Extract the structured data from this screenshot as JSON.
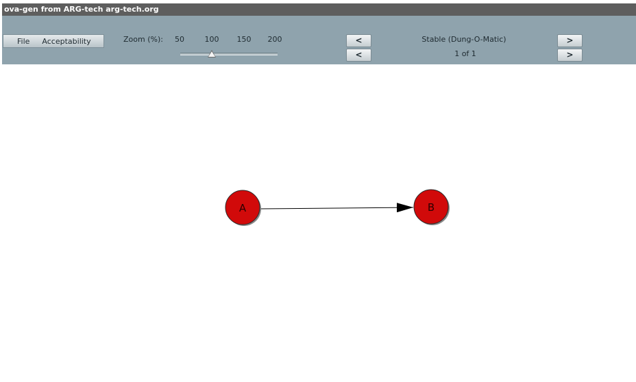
{
  "window": {
    "title": "ova-gen from ARG-tech arg-tech.org"
  },
  "menu": {
    "file": "File",
    "acceptability": "Acceptability"
  },
  "zoom": {
    "label": "Zoom (%):",
    "ticks": [
      "50",
      "100",
      "150",
      "200"
    ],
    "value_percent": 100
  },
  "semantics": {
    "prev_label": "<",
    "next_label": ">",
    "name": "Stable (Dung-O-Matic)"
  },
  "extension": {
    "prev_label": "<",
    "next_label": ">",
    "counter": "1 of 1"
  },
  "graph": {
    "nodes": [
      {
        "id": "A",
        "label": "A",
        "color": "#d10a0a"
      },
      {
        "id": "B",
        "label": "B",
        "color": "#d10a0a"
      }
    ],
    "edges": [
      {
        "from": "A",
        "to": "B"
      }
    ]
  },
  "colors": {
    "titlebar": "#5e5e5e",
    "toolbar": "#8fa3ad",
    "node_fill": "#d10a0a"
  }
}
